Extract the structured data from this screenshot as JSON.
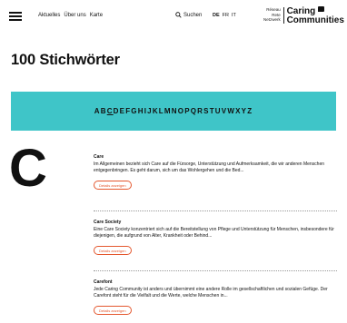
{
  "header": {
    "nav": [
      "Aktuelles",
      "Über uns",
      "Karte"
    ],
    "search_label": "Suchen",
    "languages": [
      {
        "code": "DE",
        "active": true
      },
      {
        "code": "FR",
        "active": false
      },
      {
        "code": "IT",
        "active": false
      }
    ],
    "logo": {
      "sub_lines": [
        "Réseau",
        "Rete",
        "Netzwerk"
      ],
      "main_lines": [
        "Caring",
        "Communities"
      ]
    }
  },
  "page_title": "100 Stichwörter",
  "alphabet": {
    "letters": [
      "A",
      "B",
      "C",
      "D",
      "E",
      "F",
      "G",
      "H",
      "I",
      "J",
      "K",
      "L",
      "M",
      "N",
      "O",
      "P",
      "Q",
      "R",
      "S",
      "T",
      "U",
      "V",
      "W",
      "X",
      "Y",
      "Z"
    ],
    "current": "C"
  },
  "section_letter": "C",
  "entries": [
    {
      "title": "Care",
      "text": "Im Allgemeinen bezieht sich Care auf die Fürsorge, Unterstützung und Aufmerksamkeit, die wir anderen Menschen entgegenbringen. Es geht darum, sich um das Wohlergehen und die Bed...",
      "button": "Details anzeigen"
    },
    {
      "title": "Care Society",
      "text": "Eine Care Society konzentriert sich auf die Bereitstellung von Pflege und Unterstützung für Menschen, insbesondere für diejenigen, die aufgrund von Alter, Krankheit oder Behind...",
      "button": "Details anzeigen"
    },
    {
      "title": "Carefont",
      "text": "Jede Caring Community ist anders und übernimmt eine andere Rolle im gesellschaftlichen und sozialen Gefüge. Der Carefont steht für die Vielfalt und die Werte, welche Menschen in...",
      "button": "Details anzeigen"
    }
  ],
  "colors": {
    "accent_teal": "#3fc5c8",
    "button_orange": "#e4572e"
  }
}
